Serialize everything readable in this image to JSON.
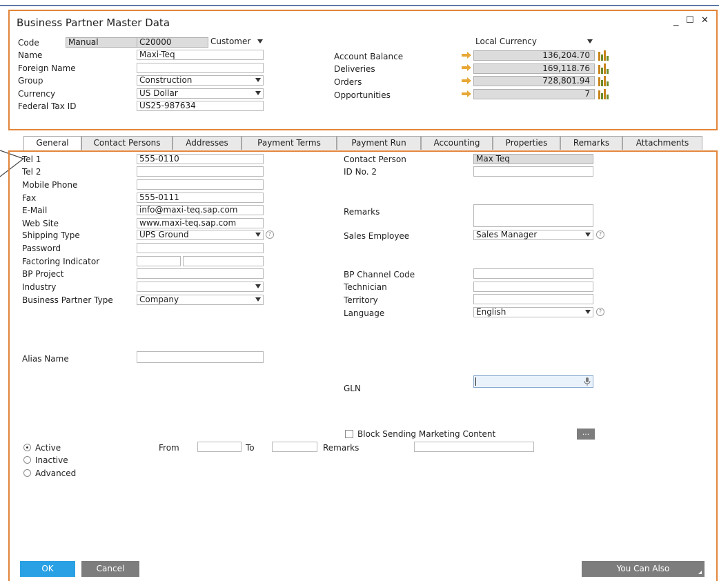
{
  "window": {
    "title": "Business Partner Master Data",
    "minimize": "_",
    "maximize": "☐",
    "close": "✕"
  },
  "header": {
    "code_label": "Code",
    "code_series": "Manual",
    "code_value": "C20000",
    "type_value": "Customer",
    "name_label": "Name",
    "name_value": "Maxi-Teq",
    "foreign_name_label": "Foreign Name",
    "foreign_name_value": "",
    "group_label": "Group",
    "group_value": "Construction",
    "currency_label": "Currency",
    "currency_value": "US Dollar",
    "tax_label": "Federal Tax ID",
    "tax_value": "US25-987634",
    "currency_mode": "Local Currency",
    "balances": [
      {
        "label": "Account Balance",
        "value": "136,204.70"
      },
      {
        "label": "Deliveries",
        "value": "169,118.76"
      },
      {
        "label": "Orders",
        "value": "728,801.94"
      },
      {
        "label": "Opportunities",
        "value": "7"
      }
    ]
  },
  "tabs": [
    {
      "label": "General",
      "active": true
    },
    {
      "label": "Contact Persons",
      "active": false
    },
    {
      "label": "Addresses",
      "active": false
    },
    {
      "label": "Payment Terms",
      "active": false
    },
    {
      "label": "Payment Run",
      "active": false
    },
    {
      "label": "Accounting",
      "active": false
    },
    {
      "label": "Properties",
      "active": false
    },
    {
      "label": "Remarks",
      "active": false
    },
    {
      "label": "Attachments",
      "active": false
    }
  ],
  "general": {
    "tel1_label": "Tel 1",
    "tel1_value": "555-0110",
    "tel2_label": "Tel 2",
    "tel2_value": "",
    "mobile_label": "Mobile Phone",
    "mobile_value": "",
    "fax_label": "Fax",
    "fax_value": "555-0111",
    "email_label": "E-Mail",
    "email_value": "info@maxi-teq.sap.com",
    "web_label": "Web Site",
    "web_value": "www.maxi-teq.sap.com",
    "shipping_label": "Shipping Type",
    "shipping_value": "UPS Ground",
    "password_label": "Password",
    "factoring_label": "Factoring Indicator",
    "bpproject_label": "BP Project",
    "industry_label": "Industry",
    "industry_value": "",
    "bptype_label": "Business Partner Type",
    "bptype_value": "Company",
    "alias_label": "Alias Name",
    "alias_value": "",
    "contact_person_label": "Contact Person",
    "contact_person_value": "Max Teq",
    "id2_label": "ID No. 2",
    "remarks_label": "Remarks",
    "sales_employee_label": "Sales Employee",
    "sales_employee_value": "Sales Manager",
    "channel_label": "BP Channel Code",
    "technician_label": "Technician",
    "territory_label": "Territory",
    "language_label": "Language",
    "language_value": "English",
    "gln_label": "GLN",
    "gln_value": "",
    "block_label": "Block Sending Marketing Content",
    "more_button": "...",
    "status_active": "Active",
    "status_inactive": "Inactive",
    "status_advanced": "Advanced",
    "from_label": "From",
    "to_label": "To",
    "status_remarks_label": "Remarks"
  },
  "footer": {
    "ok": "OK",
    "cancel": "Cancel",
    "you_can_also": "You Can Also"
  },
  "colors": {
    "accent_orange": "#e3853a",
    "ok_blue": "#2aa1e4",
    "button_gray": "#7d7d7d",
    "gln_focus": "#e9f2fb"
  },
  "icons": {
    "balance_arrow": "right-arrow-icon",
    "balance_chart": "bar-chart-icon",
    "info": "info-icon"
  }
}
